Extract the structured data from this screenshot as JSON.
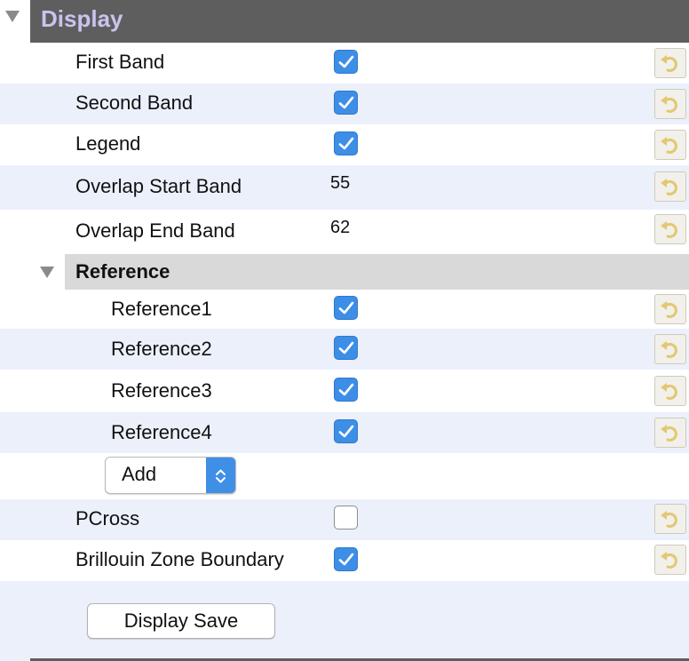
{
  "section": {
    "title": "Display"
  },
  "rows": [
    {
      "label": "First Band",
      "checked": true
    },
    {
      "label": "Second Band",
      "checked": true
    },
    {
      "label": "Legend",
      "checked": true
    },
    {
      "label": "Overlap Start Band",
      "value": "55"
    },
    {
      "label": "Overlap End Band",
      "value": "62"
    }
  ],
  "reference": {
    "title": "Reference",
    "items": [
      {
        "label": "Reference1",
        "checked": true
      },
      {
        "label": "Reference2",
        "checked": true
      },
      {
        "label": "Reference3",
        "checked": true
      },
      {
        "label": "Reference4",
        "checked": true
      }
    ],
    "add_select": {
      "value": "Add"
    }
  },
  "extra_rows": [
    {
      "label": "PCross",
      "checked": false
    },
    {
      "label": "Brillouin Zone Boundary",
      "checked": true
    }
  ],
  "save_button": {
    "label": "Display Save"
  },
  "icons": {
    "collapse": "triangle-down-icon",
    "revert": "revert-arrow-icon",
    "check": "checkmark-icon",
    "select_arrows": "updown-chevron-icon"
  },
  "colors": {
    "header_bg": "#5e5e5e",
    "header_text": "#c9c3ef",
    "row_alt": "#ebf0fb",
    "checkbox": "#3d8ee6",
    "subheader_bg": "#d9d9d9"
  }
}
